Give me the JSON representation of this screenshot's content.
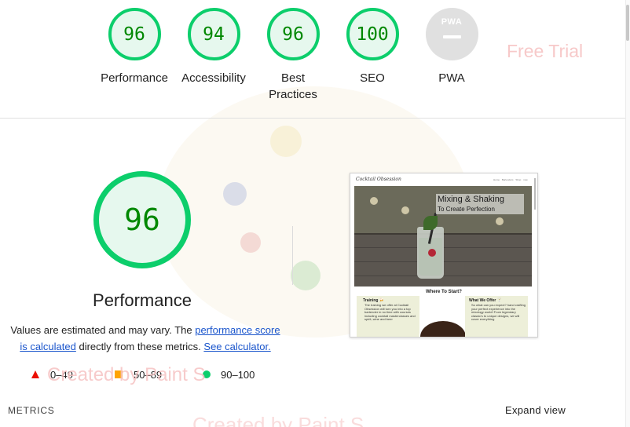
{
  "summary": {
    "gauges": [
      {
        "score": "96",
        "label": "Performance"
      },
      {
        "score": "94",
        "label": "Accessibility"
      },
      {
        "score": "96",
        "label": "Best Practices"
      },
      {
        "score": "100",
        "label": "SEO"
      }
    ],
    "pwa": {
      "badge": "PWA",
      "label": "PWA"
    }
  },
  "watermarks": {
    "trial": "Free Trial",
    "paint_small": "Created by Paint S",
    "paint_large": "Created by Paint S"
  },
  "performance": {
    "score": "96",
    "title": "Performance",
    "note_prefix": "Values are estimated and may vary. The ",
    "note_link1": "performance score is calculated",
    "note_middle": " directly from these metrics. ",
    "note_link2": "See calculator."
  },
  "legend": {
    "fail": "0–49",
    "average": "50–89",
    "pass": "90–100"
  },
  "screenshot": {
    "brand": "Cocktail Obsession",
    "nav": "Home  Bartenders  Shop now",
    "hero_title": "Mixing & Shaking",
    "hero_subtitle": "To Create Perfection",
    "section_title": "Where To Start?",
    "col1_title": "Training 🍻",
    "col1_text": "The training we offer at Cocktail Obsession will turn you into a top bartender in no time with courses including cocktail masterclasses and spirit, wine and beer",
    "col2_title": "What We Offer 🍸",
    "col2_text": "So what can you expect? hand crafting your perfect experience into the mixology world! From legendary classic's to unique designs, we will cover everything"
  },
  "footer": {
    "metrics": "METRICS",
    "expand": "Expand view"
  },
  "colors": {
    "pass": "#0cce6b",
    "pass_bg": "#e6f8ee",
    "pass_text": "#008800",
    "average": "#ffa400",
    "fail": "#eb0f00",
    "link": "#1a55cc"
  }
}
